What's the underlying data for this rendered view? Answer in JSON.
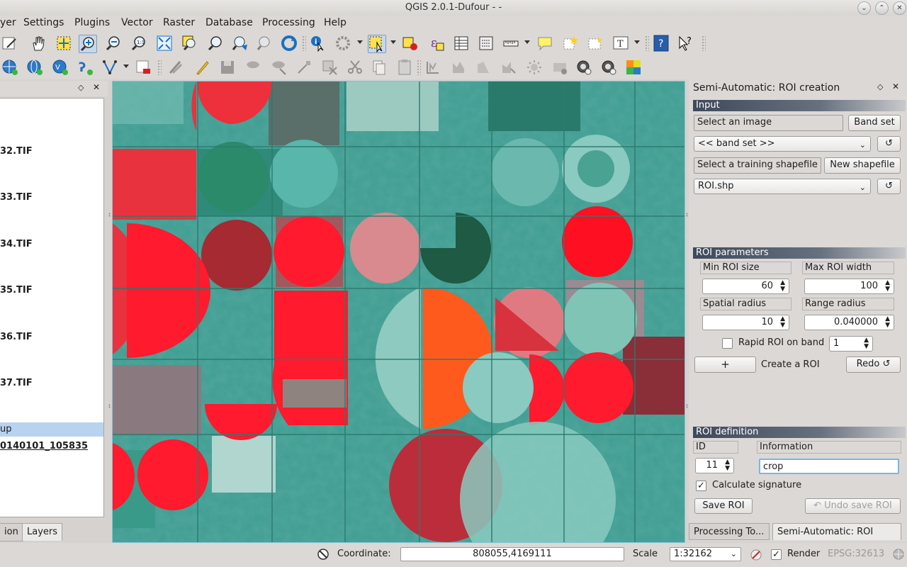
{
  "window": {
    "title": "QGIS 2.0.1-Dufour - -"
  },
  "menu": [
    "yer",
    "Settings",
    "Plugins",
    "Vector",
    "Raster",
    "Database",
    "Processing",
    "Help"
  ],
  "left_panel": {
    "items": [
      "32.TIF",
      "33.TIF",
      "34.TIF",
      "35.TIF",
      "36.TIF",
      "37.TIF"
    ],
    "group_label": "up",
    "group_child": "0140101_105835",
    "tabs": [
      "ion",
      "Layers"
    ]
  },
  "dock": {
    "title": "Semi-Automatic: ROI creation",
    "input": {
      "header": "Input",
      "image_field": "Select an image",
      "band_set_button": "Band set",
      "band_set_combo": "<< band set >>",
      "shapefile_field": "Select a training shapefile",
      "new_shapefile_button": "New shapefile",
      "shapefile_combo": "ROI.shp",
      "refresh_symbol": "↺"
    },
    "roi_params": {
      "header": "ROI parameters",
      "min_roi_size_label": "Min ROI size",
      "min_roi_size": "60",
      "max_roi_width_label": "Max ROI width",
      "max_roi_width": "100",
      "spatial_radius_label": "Spatial radius",
      "spatial_radius": "10",
      "range_radius_label": "Range radius",
      "range_radius": "0.040000",
      "rapid_roi_label": "Rapid ROI on band",
      "rapid_roi_band": "1",
      "create_plus": "+",
      "create_label": "Create a ROI",
      "redo_button": "Redo ↺"
    },
    "roi_definition": {
      "header": "ROI definition",
      "id_label": "ID",
      "id_value": "11",
      "info_label": "Information",
      "info_value": "crop",
      "calc_signature_label": "Calculate signature",
      "calc_signature_checked": true,
      "save_button": "Save ROI",
      "undo_button": "↶ Undo save ROI"
    },
    "tabs": [
      "Processing To...",
      "Semi-Automatic: ROI cre..."
    ]
  },
  "status": {
    "coordinate_label": "Coordinate:",
    "coordinate_value": "808055,4169111",
    "scale_label": "Scale",
    "scale_value": "1:32162",
    "render_label": "Render",
    "render_checked": true,
    "crs": "EPSG:32613"
  },
  "colors": {
    "accent_red": "#ff1a2e",
    "field_teal": "#3f9d92",
    "selected_orange": "#ff5a1e",
    "section_header": "#3e4a5c"
  }
}
